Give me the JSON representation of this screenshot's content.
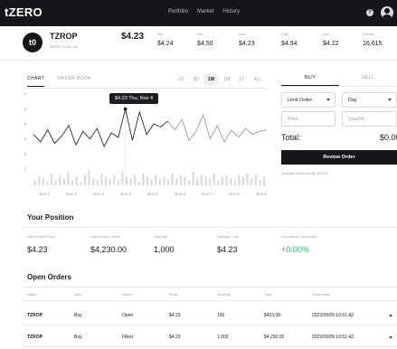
{
  "nav": {
    "logo_prefix": "t",
    "logo_main": "ZERO",
    "links": [
      "Portfolio",
      "Market",
      "History"
    ],
    "help_glyph": "?"
  },
  "ticker": {
    "logo_glyph": "t0",
    "symbol": "TZROP",
    "company": "tZERO Group Inc.",
    "price": "$4.23",
    "stats": [
      {
        "label": "Bid",
        "value": "$4.24"
      },
      {
        "label": "Ask",
        "value": "$4.50"
      },
      {
        "label": "Last",
        "value": "$4.23"
      },
      {
        "label": "High",
        "value": "$4.94"
      },
      {
        "label": "Low",
        "value": "$4.22"
      },
      {
        "label": "Volume",
        "value": "16,615"
      }
    ]
  },
  "chart_tabs": [
    "CHART",
    "ORDER BOOK"
  ],
  "ranges": [
    "1D",
    "3D",
    "1W",
    "1M",
    "1Y",
    "ALL"
  ],
  "active_range": "1W",
  "tooltip": "$4.23  Thu, Nov 4",
  "chart_data": {
    "type": "line",
    "y_ticks": [
      "7",
      "6",
      "5",
      "4",
      "3",
      "2"
    ],
    "x_labels": [
      "Nov 1",
      "Nov 2",
      "Nov 3",
      "Nov 4",
      "Nov 5",
      "Nov 6",
      "Nov 7",
      "Nov 8",
      "Nov 9"
    ],
    "ylim": [
      1.5,
      7
    ],
    "series": [
      {
        "dark_until_index": 19,
        "values": [
          4.3,
          3.8,
          4.6,
          3.7,
          4.2,
          4.9,
          3.6,
          4.5,
          4.0,
          4.7,
          3.5,
          4.4,
          4.1,
          6.0,
          3.9,
          5.8,
          4.3,
          5.0,
          4.8,
          5.2,
          4.6,
          5.3,
          3.9,
          4.5,
          5.6,
          4.0,
          4.9,
          3.8,
          4.6,
          4.1,
          4.7,
          4.3,
          4.5,
          4.6
        ]
      }
    ],
    "volume": [
      0.3,
      0.5,
      0.4,
      0.2,
      0.7,
      0.3,
      0.6,
      0.4,
      0.8,
      0.3,
      0.5,
      0.2,
      0.6,
      0.9,
      0.4,
      0.3,
      0.7,
      0.5,
      0.4,
      0.6,
      0.3,
      0.8,
      0.5,
      0.4,
      0.6,
      0.2,
      0.7,
      0.5,
      0.3,
      0.6,
      0.4,
      0.5,
      0.3,
      0.7,
      0.4,
      0.6,
      0.5,
      0.3,
      0.8,
      0.4,
      0.6,
      0.5,
      0.4,
      0.7,
      0.3,
      0.5,
      0.6,
      0.4,
      0.3,
      0.6,
      0.5,
      0.7,
      0.4,
      0.6,
      0.3,
      0.5
    ]
  },
  "order": {
    "tabs": [
      "BUY",
      "SELL"
    ],
    "order_type": "Limit Order",
    "duration": "Day",
    "price_placeholder": "Price",
    "quantity_placeholder": "Quantity",
    "total_label": "Total:",
    "total_value": "$0.00",
    "review_label": "Review Order",
    "balance": "Available Balance: $9,800.00"
  },
  "position": {
    "title": "Your Position",
    "cols": [
      {
        "label": "Last Known Price",
        "value": "$4.23"
      },
      {
        "label": "Last Known Value*",
        "value": "$4,230.00"
      },
      {
        "label": "Quantity",
        "value": "1,000"
      },
      {
        "label": "Average Cost",
        "value": "$4.23"
      },
      {
        "label": "Unrealized Gain/Loss*",
        "value": "+0.00%"
      }
    ]
  },
  "orders": {
    "title": "Open Orders",
    "headers": [
      "Name",
      "Side",
      "Status",
      "Price",
      "Quantity",
      "Total",
      "Order Date"
    ],
    "rows": [
      [
        "TZROP",
        "Buy",
        "Open",
        "$4.23",
        "100",
        "$423.00",
        "2022/09/09 10:51:42"
      ],
      [
        "TZROP",
        "Buy",
        "Filled",
        "$4.23",
        "1,000",
        "$4,230.00",
        "2022/09/09 10:51:42"
      ]
    ]
  },
  "colors": {
    "nav_bg": "#15161a",
    "accent_dark": "#15161a",
    "gain_green": "#2fb86b"
  }
}
